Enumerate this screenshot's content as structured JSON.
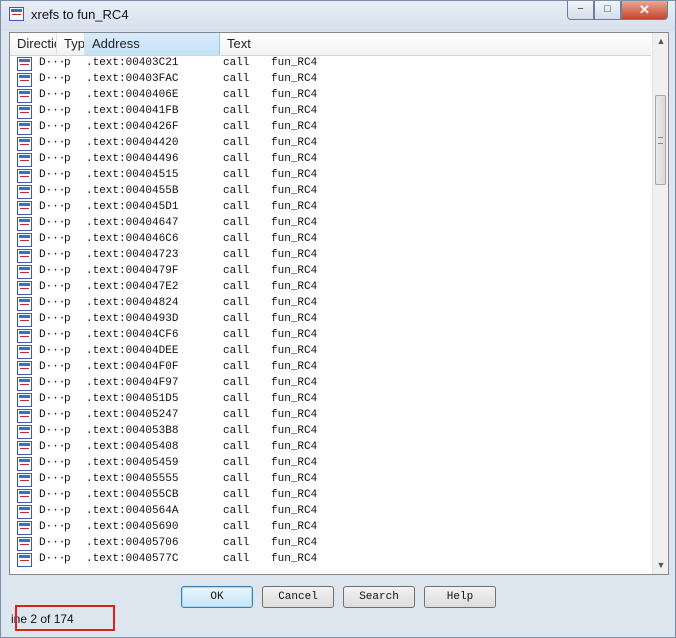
{
  "window": {
    "title": "xrefs to fun_RC4",
    "icon": "xref-window-icon"
  },
  "window_controls": {
    "minimize": "−",
    "maximize": "□",
    "close": "✕"
  },
  "columns": [
    "Directio",
    "Typ",
    "Address",
    "Text"
  ],
  "selected_column": "Address",
  "rows": [
    {
      "dir": "D···",
      "type": "p",
      "address": ".text:00403C21",
      "op": "call",
      "target": "fun_RC4"
    },
    {
      "dir": "D···",
      "type": "p",
      "address": ".text:00403FAC",
      "op": "call",
      "target": "fun_RC4"
    },
    {
      "dir": "D···",
      "type": "p",
      "address": ".text:0040406E",
      "op": "call",
      "target": "fun_RC4"
    },
    {
      "dir": "D···",
      "type": "p",
      "address": ".text:004041FB",
      "op": "call",
      "target": "fun_RC4"
    },
    {
      "dir": "D···",
      "type": "p",
      "address": ".text:0040426F",
      "op": "call",
      "target": "fun_RC4"
    },
    {
      "dir": "D···",
      "type": "p",
      "address": ".text:00404420",
      "op": "call",
      "target": "fun_RC4"
    },
    {
      "dir": "D···",
      "type": "p",
      "address": ".text:00404496",
      "op": "call",
      "target": "fun_RC4"
    },
    {
      "dir": "D···",
      "type": "p",
      "address": ".text:00404515",
      "op": "call",
      "target": "fun_RC4"
    },
    {
      "dir": "D···",
      "type": "p",
      "address": ".text:0040455B",
      "op": "call",
      "target": "fun_RC4"
    },
    {
      "dir": "D···",
      "type": "p",
      "address": ".text:004045D1",
      "op": "call",
      "target": "fun_RC4"
    },
    {
      "dir": "D···",
      "type": "p",
      "address": ".text:00404647",
      "op": "call",
      "target": "fun_RC4"
    },
    {
      "dir": "D···",
      "type": "p",
      "address": ".text:004046C6",
      "op": "call",
      "target": "fun_RC4"
    },
    {
      "dir": "D···",
      "type": "p",
      "address": ".text:00404723",
      "op": "call",
      "target": "fun_RC4"
    },
    {
      "dir": "D···",
      "type": "p",
      "address": ".text:0040479F",
      "op": "call",
      "target": "fun_RC4"
    },
    {
      "dir": "D···",
      "type": "p",
      "address": ".text:004047E2",
      "op": "call",
      "target": "fun_RC4"
    },
    {
      "dir": "D···",
      "type": "p",
      "address": ".text:00404824",
      "op": "call",
      "target": "fun_RC4"
    },
    {
      "dir": "D···",
      "type": "p",
      "address": ".text:0040493D",
      "op": "call",
      "target": "fun_RC4"
    },
    {
      "dir": "D···",
      "type": "p",
      "address": ".text:00404CF6",
      "op": "call",
      "target": "fun_RC4"
    },
    {
      "dir": "D···",
      "type": "p",
      "address": ".text:00404DEE",
      "op": "call",
      "target": "fun_RC4"
    },
    {
      "dir": "D···",
      "type": "p",
      "address": ".text:00404F0F",
      "op": "call",
      "target": "fun_RC4"
    },
    {
      "dir": "D···",
      "type": "p",
      "address": ".text:00404F97",
      "op": "call",
      "target": "fun_RC4"
    },
    {
      "dir": "D···",
      "type": "p",
      "address": ".text:004051D5",
      "op": "call",
      "target": "fun_RC4"
    },
    {
      "dir": "D···",
      "type": "p",
      "address": ".text:00405247",
      "op": "call",
      "target": "fun_RC4"
    },
    {
      "dir": "D···",
      "type": "p",
      "address": ".text:004053B8",
      "op": "call",
      "target": "fun_RC4"
    },
    {
      "dir": "D···",
      "type": "p",
      "address": ".text:00405408",
      "op": "call",
      "target": "fun_RC4"
    },
    {
      "dir": "D···",
      "type": "p",
      "address": ".text:00405459",
      "op": "call",
      "target": "fun_RC4"
    },
    {
      "dir": "D···",
      "type": "p",
      "address": ".text:00405555",
      "op": "call",
      "target": "fun_RC4"
    },
    {
      "dir": "D···",
      "type": "p",
      "address": ".text:004055CB",
      "op": "call",
      "target": "fun_RC4"
    },
    {
      "dir": "D···",
      "type": "p",
      "address": ".text:0040564A",
      "op": "call",
      "target": "fun_RC4"
    },
    {
      "dir": "D···",
      "type": "p",
      "address": ".text:00405690",
      "op": "call",
      "target": "fun_RC4"
    },
    {
      "dir": "D···",
      "type": "p",
      "address": ".text:00405706",
      "op": "call",
      "target": "fun_RC4"
    },
    {
      "dir": "D···",
      "type": "p",
      "address": ".text:0040577C",
      "op": "call",
      "target": "fun_RC4"
    }
  ],
  "buttons": {
    "ok": "OK",
    "cancel": "Cancel",
    "search": "Search",
    "help": "Help"
  },
  "status": "ine 2 of 174",
  "colors": {
    "highlight": "#e02020",
    "header_selected": "#c4e1f7"
  },
  "scroll_arrows": {
    "up": "▲",
    "down": "▼"
  }
}
